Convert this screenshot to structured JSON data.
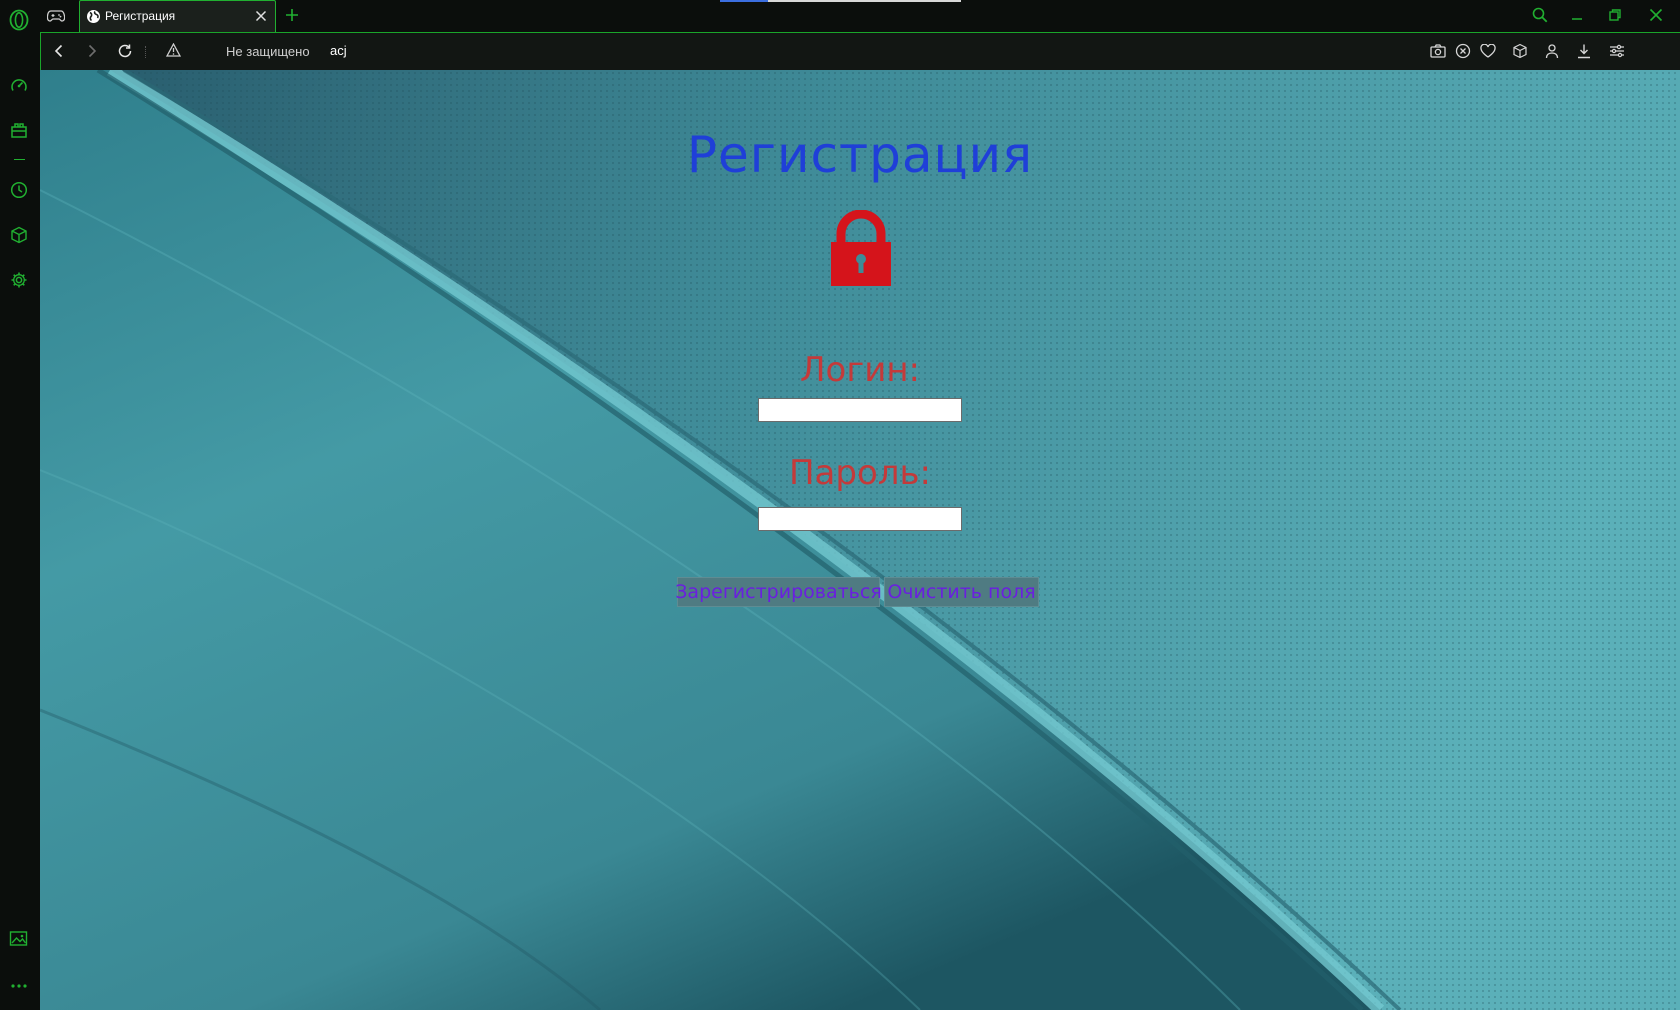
{
  "tab": {
    "title": "Регистрация"
  },
  "address_bar": {
    "security_label": "Не защищено",
    "url": "acj"
  },
  "page": {
    "heading": "Регистрация",
    "login_label": "Логин:",
    "login_value": "",
    "password_label": "Пароль:",
    "password_value": "",
    "register_button": "Зарегистрироваться",
    "clear_button": "Очистить поля"
  },
  "icons": {
    "sidebar": [
      "opera-logo-icon",
      "speed-dial-icon",
      "extensions-box-icon",
      "history-icon",
      "package-icon",
      "settings-icon",
      "gallery-icon",
      "more-icon"
    ],
    "toolbar": [
      "camera-icon",
      "adblock-icon",
      "heart-icon",
      "cube-icon",
      "profile-icon",
      "download-icon",
      "easy-setup-icon"
    ]
  },
  "colors": {
    "accent_green": "#21b031",
    "heading_blue": "#1f3fd8",
    "label_red": "#c43a3a",
    "lock_red": "#d5141b",
    "button_text_violet": "#6a1fe0"
  }
}
